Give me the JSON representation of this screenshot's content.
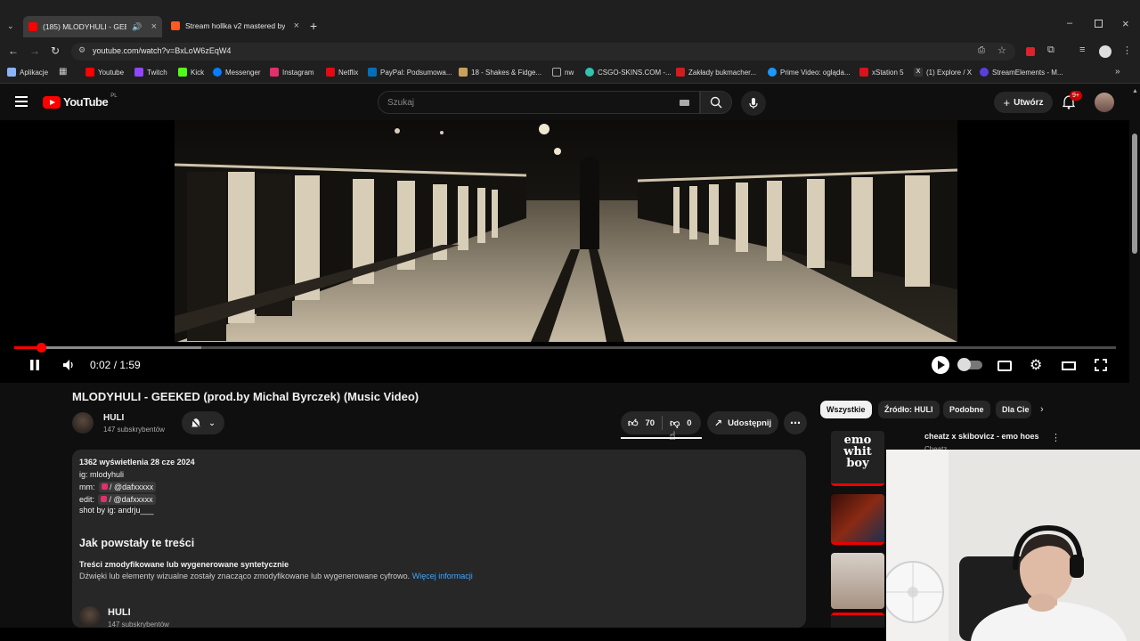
{
  "browser": {
    "tabs": [
      {
        "label": "(185) MLODYHULI - GEEKE",
        "favicon_color": "#ff0000"
      },
      {
        "label": "Stream hollka v2 mastered by h",
        "favicon_color": "#ff5a1f"
      }
    ],
    "url": "youtube.com/watch?v=BxLoW6zEqW4",
    "bookmarks": [
      {
        "label": "Aplikacje",
        "color": "#8ab4f8"
      },
      {
        "label": "Youtube",
        "color": "#ff0000"
      },
      {
        "label": "Twitch",
        "color": "#9146ff"
      },
      {
        "label": "Kick",
        "color": "#53fc18"
      },
      {
        "label": "Messenger",
        "color": "#0a7cff"
      },
      {
        "label": "Instagram",
        "color": "#e1306c"
      },
      {
        "label": "Netflix",
        "color": "#e50914"
      },
      {
        "label": "PayPal: Podsumowa...",
        "color": "#0070ba"
      },
      {
        "label": "18 - Shakes & Fidge...",
        "color": "#c9a15c"
      },
      {
        "label": "nw",
        "color": "#aaaaaa"
      },
      {
        "label": "CSGO-SKINS.COM -...",
        "color": "#34c1b0"
      },
      {
        "label": "Zakłady bukmacher...",
        "color": "#d31c1c"
      },
      {
        "label": "Prime Video: ogląda...",
        "color": "#1a98ff"
      },
      {
        "label": "xStation 5",
        "color": "#d7141a"
      },
      {
        "label": "(1) Explore / X",
        "color": "#dddddd"
      },
      {
        "label": "StreamElements - M...",
        "color": "#5a3fe0"
      }
    ]
  },
  "header": {
    "logo_text": "YouTube",
    "region": "PL",
    "search_placeholder": "Szukaj",
    "create_label": "Utwórz",
    "notif_count": "9+"
  },
  "player": {
    "time": "0:02 / 1:59",
    "progress_played": 0.024,
    "progress_buffered": 0.17
  },
  "video": {
    "title": "MLODYHULI - GEEKED (prod.by Michal Byrczek) (Music Video)",
    "channel": "HULI",
    "subscribers": "147 subskrybentów",
    "likes": "70",
    "dislikes": "0",
    "share_label": "Udostępnij"
  },
  "description": {
    "stats": "1362 wyświetlenia  28 cze 2024",
    "lines": [
      {
        "prefix": "ig: mlodyhuli",
        "tag": ""
      },
      {
        "prefix": "mm:",
        "tag": "@dafxxxxx"
      },
      {
        "prefix": "edit:",
        "tag": "@dafxxxxx"
      },
      {
        "prefix": "shot by ig: andrju___",
        "tag": ""
      }
    ],
    "section_title": "Jak powstały te treści",
    "ai_title": "Treści zmodyfikowane lub wygenerowane syntetycznie",
    "ai_text": "Dźwięki lub elementy wizualne zostały znacząco zmodyfikowane lub wygenerowane cyfrowo.",
    "ai_link": "Więcej informacji",
    "channel_name": "HULI",
    "channel_subs": "147 subskrybentów"
  },
  "sidebar": {
    "chips": [
      "Wszystkie",
      "Źródło: HULI",
      "Podobne",
      "Dla Cie"
    ],
    "items": [
      {
        "title": "cheatz x skibovicz - emo hoes",
        "channel": "Cheatz"
      }
    ]
  }
}
